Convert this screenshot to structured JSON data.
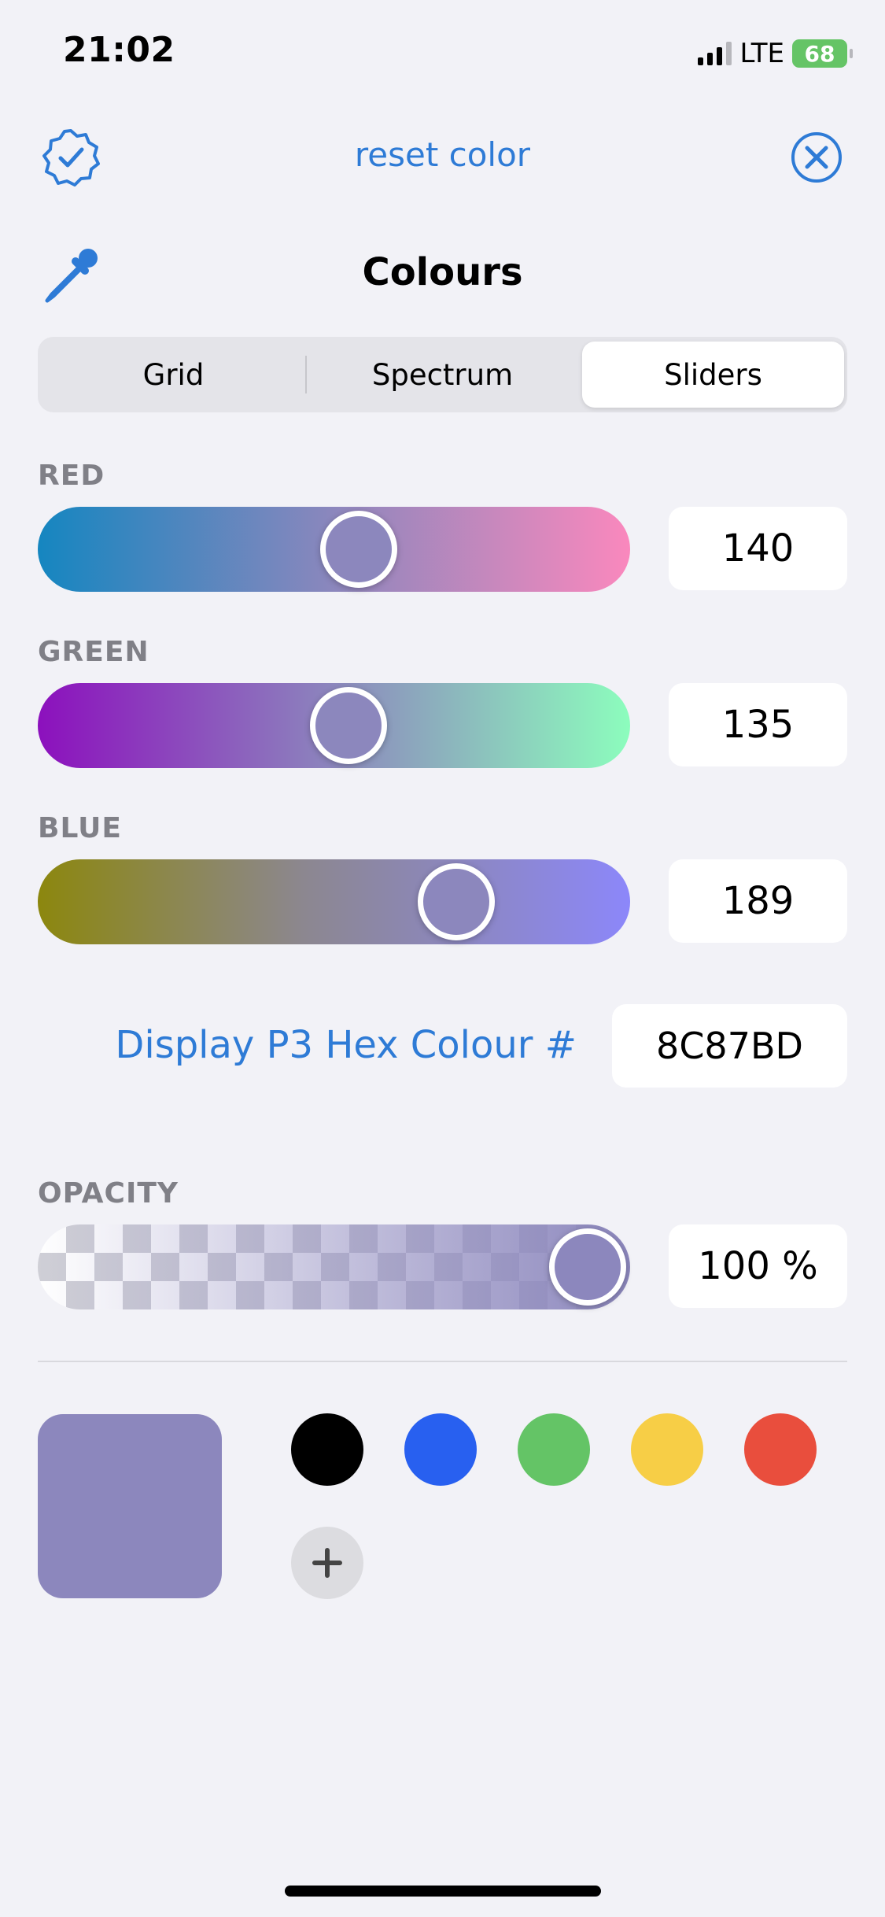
{
  "status_bar": {
    "time": "21:02",
    "network": "LTE",
    "battery": "68"
  },
  "header": {
    "reset_label": "reset color",
    "title": "Colours",
    "left_icon": "checkmark-seal-icon",
    "close_icon": "close-circle-icon",
    "picker_icon": "eyedropper-icon"
  },
  "tabs": [
    {
      "label": "Grid",
      "active": false
    },
    {
      "label": "Spectrum",
      "active": false
    },
    {
      "label": "Sliders",
      "active": true
    }
  ],
  "sliders": {
    "red": {
      "label": "RED",
      "value": "140",
      "fraction": 0.549
    },
    "green": {
      "label": "GREEN",
      "value": "135",
      "fraction": 0.529
    },
    "blue": {
      "label": "BLUE",
      "value": "189",
      "fraction": 0.741
    }
  },
  "hex": {
    "label": "Display P3 Hex Colour #",
    "value": "8C87BD"
  },
  "opacity": {
    "label": "OPACITY",
    "value": "100 %",
    "fraction": 1.0
  },
  "current_color": "#8c87bd",
  "swatches": [
    "#000000",
    "#2860f0",
    "#64c466",
    "#f7ce46",
    "#e94e3d"
  ],
  "add_swatch_icon": "plus-icon",
  "colors": {
    "accent": "#2e7bd6",
    "background": "#f2f2f7"
  }
}
